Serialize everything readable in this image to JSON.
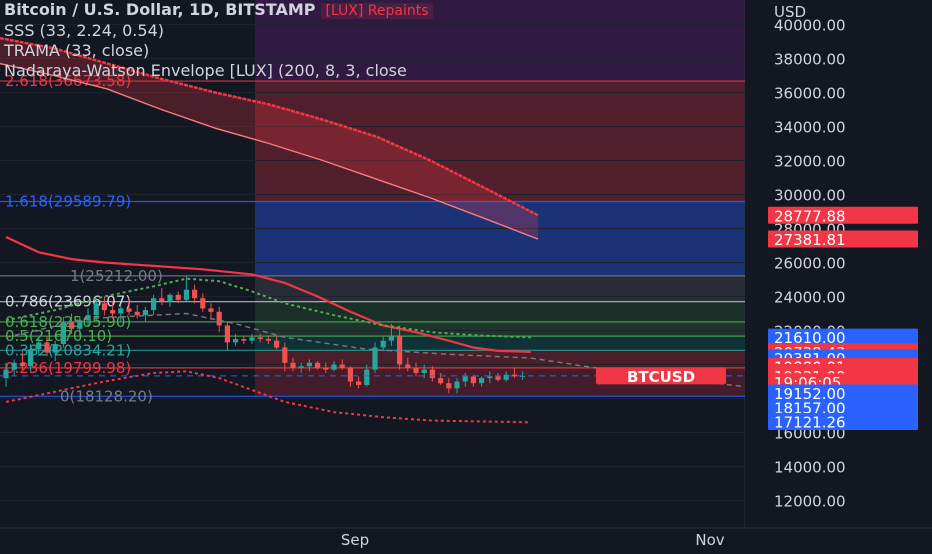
{
  "legend": {
    "title": "Bitcoin / U.S. Dollar, 1D, BITSTAMP",
    "sss": "SSS (33, 2.24, 0.54)",
    "trama": "TRAMA (33, close)",
    "nwe": "Nadaraya-Watson Envelope [LUX] (200, 8, 3, close",
    "repaint": "[LUX] Repaints"
  },
  "colors": {
    "background": "#131722",
    "bull": "#26a69a",
    "bear": "#ef5350",
    "fib_blue": "#2962ff",
    "upper_band": "#f23645",
    "trama": "#f23645",
    "sss_green": "#4caf50"
  },
  "chart_data": {
    "type": "candlestick",
    "symbol": "BTCUSD",
    "ylabel": "USD",
    "ylim": [
      10800,
      40800
    ],
    "y_ticks": [
      "40000.00",
      "38000.00",
      "36000.00",
      "34000.00",
      "32000.00",
      "30000.00",
      "28000.00",
      "26000.00",
      "24000.00",
      "22000.00",
      "18000.00",
      "16000.00",
      "14000.00",
      "12000.00"
    ],
    "x_ticks": [
      "Sep",
      "Nov"
    ],
    "fib_levels": [
      {
        "label": "2.618(36673.58)",
        "value": 36673.58
      },
      {
        "label": "1.618(29589.79)",
        "value": 29589.79
      },
      {
        "label": "1(25212.00)",
        "value": 25212.0
      },
      {
        "label": "0.786(23696.07)",
        "value": 23696.07
      },
      {
        "label": "0.618(22505.90)",
        "value": 22505.9
      },
      {
        "label": "0.5(21670.10)",
        "value": 21670.1
      },
      {
        "label": "0.382(20834.21)",
        "value": 20834.21
      },
      {
        "label": "0.236(19799.98)",
        "value": 19799.98
      },
      {
        "label": "0(18128.20)",
        "value": 18128.2
      }
    ],
    "price_badges": [
      {
        "label": "28777.88",
        "value": 28777.88,
        "color": "#f23645"
      },
      {
        "label": "27381.81",
        "value": 27381.81,
        "color": "#f23645"
      },
      {
        "label": "21610.00",
        "value": 21610.0,
        "color": "#2962ff"
      },
      {
        "label": "20738.43",
        "value": 20738.43,
        "color": "#f23645"
      },
      {
        "label": "20381.00",
        "value": 20381.0,
        "color": "#2962ff"
      },
      {
        "label": "19880.01",
        "value": 19880.01,
        "color": "#f23645"
      },
      {
        "label": "19531.59",
        "value": 19531.59,
        "color": "#f23645"
      },
      {
        "label": "19331.00",
        "value": 19331.0,
        "color": "#f23645"
      },
      {
        "label": "19:06:05",
        "value": 18980,
        "color": "#f23645"
      },
      {
        "label": "19152.00",
        "value": 18320,
        "color": "#2962ff"
      },
      {
        "label": "18157.00",
        "value": 17470,
        "color": "#2962ff"
      },
      {
        "label": "17121.26",
        "value": 16650,
        "color": "#2962ff"
      }
    ],
    "symbol_badge": {
      "label": "BTCUSD",
      "value": 19331.0
    },
    "candles": [
      {
        "o": 19200,
        "h": 20100,
        "l": 18700,
        "c": 19700
      },
      {
        "o": 19700,
        "h": 20300,
        "l": 19300,
        "c": 20100
      },
      {
        "o": 20100,
        "h": 20800,
        "l": 19700,
        "c": 19900
      },
      {
        "o": 19900,
        "h": 21200,
        "l": 19600,
        "c": 20900
      },
      {
        "o": 20900,
        "h": 21600,
        "l": 20500,
        "c": 21300
      },
      {
        "o": 21300,
        "h": 21700,
        "l": 20500,
        "c": 20700
      },
      {
        "o": 20700,
        "h": 21400,
        "l": 20200,
        "c": 21200
      },
      {
        "o": 21200,
        "h": 22800,
        "l": 21000,
        "c": 22500
      },
      {
        "o": 22500,
        "h": 23000,
        "l": 21800,
        "c": 22100
      },
      {
        "o": 22100,
        "h": 22800,
        "l": 21700,
        "c": 22600
      },
      {
        "o": 22600,
        "h": 23300,
        "l": 22200,
        "c": 22900
      },
      {
        "o": 22900,
        "h": 23900,
        "l": 22600,
        "c": 23600
      },
      {
        "o": 23600,
        "h": 24000,
        "l": 22900,
        "c": 23200
      },
      {
        "o": 23200,
        "h": 23700,
        "l": 22700,
        "c": 23000
      },
      {
        "o": 23000,
        "h": 23500,
        "l": 22500,
        "c": 23300
      },
      {
        "o": 23300,
        "h": 23900,
        "l": 22900,
        "c": 23100
      },
      {
        "o": 23100,
        "h": 23500,
        "l": 22700,
        "c": 22900
      },
      {
        "o": 22900,
        "h": 23400,
        "l": 22500,
        "c": 23200
      },
      {
        "o": 23200,
        "h": 24100,
        "l": 22900,
        "c": 23900
      },
      {
        "o": 23900,
        "h": 24500,
        "l": 23500,
        "c": 23700
      },
      {
        "o": 23700,
        "h": 24200,
        "l": 23400,
        "c": 24100
      },
      {
        "o": 24100,
        "h": 24300,
        "l": 23600,
        "c": 23800
      },
      {
        "o": 23800,
        "h": 25200,
        "l": 23700,
        "c": 24400
      },
      {
        "o": 24400,
        "h": 24700,
        "l": 23600,
        "c": 23900
      },
      {
        "o": 23900,
        "h": 24200,
        "l": 23100,
        "c": 23300
      },
      {
        "o": 23300,
        "h": 23600,
        "l": 22600,
        "c": 23100
      },
      {
        "o": 23100,
        "h": 23400,
        "l": 21900,
        "c": 22300
      },
      {
        "o": 22300,
        "h": 22500,
        "l": 20800,
        "c": 21300
      },
      {
        "o": 21300,
        "h": 21800,
        "l": 21100,
        "c": 21500
      },
      {
        "o": 21500,
        "h": 21700,
        "l": 21200,
        "c": 21400
      },
      {
        "o": 21400,
        "h": 21800,
        "l": 21200,
        "c": 21600
      },
      {
        "o": 21600,
        "h": 21800,
        "l": 21300,
        "c": 21500
      },
      {
        "o": 21500,
        "h": 21700,
        "l": 21200,
        "c": 21400
      },
      {
        "o": 21400,
        "h": 21700,
        "l": 20900,
        "c": 21000
      },
      {
        "o": 21000,
        "h": 21300,
        "l": 19600,
        "c": 20100
      },
      {
        "o": 20100,
        "h": 20400,
        "l": 19600,
        "c": 19800
      },
      {
        "o": 19800,
        "h": 20100,
        "l": 19500,
        "c": 19900
      },
      {
        "o": 19900,
        "h": 20300,
        "l": 19600,
        "c": 20100
      },
      {
        "o": 20100,
        "h": 20200,
        "l": 19700,
        "c": 19800
      },
      {
        "o": 19800,
        "h": 20100,
        "l": 19500,
        "c": 19700
      },
      {
        "o": 19700,
        "h": 20200,
        "l": 19600,
        "c": 20000
      },
      {
        "o": 20000,
        "h": 20300,
        "l": 19700,
        "c": 19800
      },
      {
        "o": 19800,
        "h": 19900,
        "l": 18700,
        "c": 19000
      },
      {
        "o": 19000,
        "h": 19300,
        "l": 18600,
        "c": 18800
      },
      {
        "o": 18800,
        "h": 20000,
        "l": 18700,
        "c": 19700
      },
      {
        "o": 19700,
        "h": 21300,
        "l": 19500,
        "c": 21000
      },
      {
        "o": 21000,
        "h": 21700,
        "l": 20800,
        "c": 21400
      },
      {
        "o": 21400,
        "h": 22400,
        "l": 21100,
        "c": 21700
      },
      {
        "o": 21700,
        "h": 22300,
        "l": 19700,
        "c": 20000
      },
      {
        "o": 20000,
        "h": 20400,
        "l": 19600,
        "c": 19800
      },
      {
        "o": 19800,
        "h": 20100,
        "l": 19300,
        "c": 19500
      },
      {
        "o": 19500,
        "h": 20000,
        "l": 19200,
        "c": 19700
      },
      {
        "o": 19700,
        "h": 19900,
        "l": 19000,
        "c": 19200
      },
      {
        "o": 19200,
        "h": 19500,
        "l": 18800,
        "c": 18900
      },
      {
        "o": 18900,
        "h": 19200,
        "l": 18300,
        "c": 18600
      },
      {
        "o": 18600,
        "h": 19200,
        "l": 18300,
        "c": 19000
      },
      {
        "o": 19000,
        "h": 19500,
        "l": 18700,
        "c": 19300
      },
      {
        "o": 19300,
        "h": 19400,
        "l": 18700,
        "c": 18900
      },
      {
        "o": 18900,
        "h": 19300,
        "l": 18700,
        "c": 19200
      },
      {
        "o": 19200,
        "h": 19600,
        "l": 18900,
        "c": 19300
      },
      {
        "o": 19300,
        "h": 19500,
        "l": 19000,
        "c": 19100
      },
      {
        "o": 19100,
        "h": 19600,
        "l": 19000,
        "c": 19400
      },
      {
        "o": 19400,
        "h": 19800,
        "l": 19200,
        "c": 19300
      },
      {
        "o": 19300,
        "h": 19600,
        "l": 19100,
        "c": 19331
      }
    ],
    "upper_envelope": [
      [
        0,
        39200
      ],
      [
        10,
        38600
      ],
      [
        20,
        37700
      ],
      [
        30,
        36800
      ],
      [
        40,
        36000
      ],
      [
        50,
        35300
      ],
      [
        60,
        34400
      ],
      [
        70,
        33400
      ],
      [
        80,
        32000
      ],
      [
        90,
        30400
      ],
      [
        100,
        28780
      ]
    ],
    "lower_envelope": [
      [
        0,
        37700
      ],
      [
        10,
        37000
      ],
      [
        20,
        36200
      ],
      [
        30,
        35000
      ],
      [
        40,
        33900
      ],
      [
        50,
        33000
      ],
      [
        60,
        32000
      ],
      [
        70,
        30900
      ],
      [
        80,
        29800
      ],
      [
        90,
        28600
      ],
      [
        100,
        27380
      ]
    ],
    "trama": [
      [
        0,
        27500
      ],
      [
        4,
        26600
      ],
      [
        8,
        26200
      ],
      [
        12,
        26000
      ],
      [
        18,
        25800
      ],
      [
        24,
        25600
      ],
      [
        30,
        25300
      ],
      [
        34,
        24800
      ],
      [
        38,
        24000
      ],
      [
        42,
        23100
      ],
      [
        46,
        22300
      ],
      [
        50,
        21900
      ],
      [
        54,
        21400
      ],
      [
        57,
        21000
      ],
      [
        60,
        20800
      ],
      [
        64,
        20740
      ]
    ],
    "sss_green": [
      [
        0,
        22600
      ],
      [
        6,
        23200
      ],
      [
        12,
        24000
      ],
      [
        18,
        24600
      ],
      [
        22,
        25050
      ],
      [
        26,
        24900
      ],
      [
        30,
        24300
      ],
      [
        34,
        23600
      ],
      [
        40,
        22900
      ],
      [
        46,
        22300
      ],
      [
        52,
        21900
      ],
      [
        58,
        21700
      ],
      [
        64,
        21600
      ]
    ],
    "sss_red_lower": [
      [
        0,
        17800
      ],
      [
        6,
        18400
      ],
      [
        12,
        19000
      ],
      [
        18,
        19500
      ],
      [
        22,
        19600
      ],
      [
        26,
        19200
      ],
      [
        30,
        18500
      ],
      [
        34,
        17800
      ],
      [
        40,
        17200
      ],
      [
        46,
        16900
      ],
      [
        52,
        16700
      ],
      [
        58,
        16650
      ],
      [
        64,
        16600
      ]
    ],
    "sss_mid": [
      [
        0,
        21600
      ],
      [
        10,
        22700
      ],
      [
        22,
        23000
      ],
      [
        28,
        22400
      ],
      [
        34,
        21600
      ],
      [
        44,
        20900
      ],
      [
        54,
        20600
      ],
      [
        64,
        20381
      ],
      [
        76,
        19500
      ],
      [
        90,
        18700
      ]
    ]
  }
}
